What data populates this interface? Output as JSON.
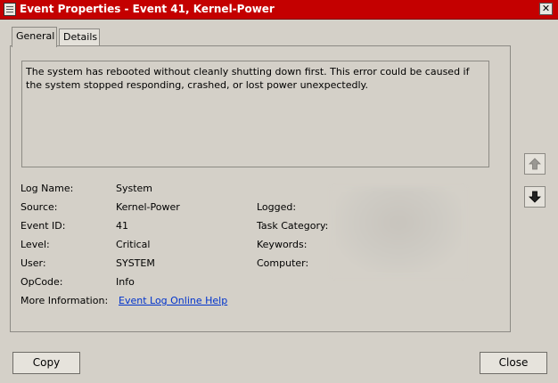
{
  "window": {
    "title": "Event Properties - Event 41, Kernel-Power",
    "close_glyph": "✕"
  },
  "tabs": [
    {
      "label": "General",
      "active": true
    },
    {
      "label": "Details",
      "active": false
    }
  ],
  "description": "The system has rebooted without cleanly shutting down first. This error could be caused if the system stopped responding, crashed, or lost power unexpectedly.",
  "fields": {
    "log_name": {
      "label": "Log Name:",
      "value": "System"
    },
    "source": {
      "label": "Source:",
      "value": "Kernel-Power"
    },
    "event_id": {
      "label": "Event ID:",
      "value": "41"
    },
    "level": {
      "label": "Level:",
      "value": "Critical"
    },
    "user": {
      "label": "User:",
      "value": "SYSTEM"
    },
    "opcode": {
      "label": "OpCode:",
      "value": "Info"
    },
    "more_info": {
      "label": "More Information:",
      "link": "Event Log Online Help"
    },
    "logged": {
      "label": "Logged:"
    },
    "task_category": {
      "label": "Task Category:"
    },
    "keywords": {
      "label": "Keywords:"
    },
    "computer": {
      "label": "Computer:"
    }
  },
  "side_buttons": {
    "up_icon": "arrow-up-icon",
    "down_icon": "arrow-down-icon"
  },
  "buttons": {
    "copy": "Copy",
    "close": "Close"
  },
  "colors": {
    "titlebar": "#c40000",
    "window_bg": "#d4d0c8",
    "link": "#0033cc"
  }
}
